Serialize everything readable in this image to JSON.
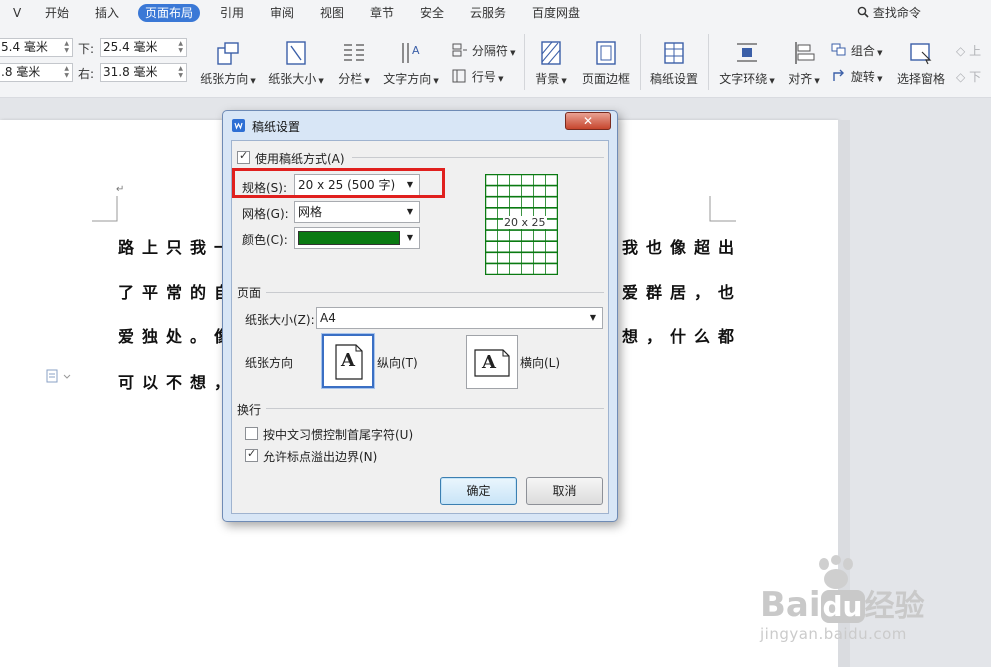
{
  "menu": {
    "collapse_glyph": "ᐯ",
    "items": [
      "开始",
      "插入",
      "页面布局",
      "引用",
      "审阅",
      "视图",
      "章节",
      "安全",
      "云服务",
      "百度网盘"
    ],
    "active_index": 2,
    "search_label": "查找命令"
  },
  "margins": {
    "top_value": "5.4 毫米",
    "left_value": ".8 毫米",
    "bottom_label": "下:",
    "bottom_value": "25.4 毫米",
    "right_label": "右:",
    "right_value": "31.8 毫米"
  },
  "ribbon": {
    "orientation": "纸张方向",
    "size": "纸张大小",
    "columns": "分栏",
    "text_direction": "文字方向",
    "separator": "分隔符",
    "line_number": "行号",
    "background": "背景",
    "page_border": "页面边框",
    "manuscript": "稿纸设置",
    "wrap": "文字环绕",
    "align": "对齐",
    "group": "组合",
    "rotate": "旋转",
    "selection_pane": "选择窗格",
    "up": "上",
    "down": "下"
  },
  "document": {
    "lines": [
      "路上只我一",
      "了平常的自",
      "爱独处。像",
      "可以不想，"
    ],
    "right_lines": [
      "我也像超出",
      "爱群居，也",
      "想，什么都",
      ""
    ]
  },
  "dialog": {
    "title": "稿纸设置",
    "use_manuscript_label": "使用稿纸方式(A)",
    "use_manuscript_checked": true,
    "spec_label": "规格(S):",
    "spec_value": "20 x 25 (500 字)",
    "grid_label": "网格(G):",
    "grid_value": "网格",
    "color_label": "颜色(C):",
    "color_value": "#0a7a12",
    "preview_text": "20 x 25",
    "page_section": "页面",
    "paper_size_label": "纸张大小(Z):",
    "paper_size_value": "A4",
    "orientation_label": "纸张方向",
    "portrait_label": "纵向(T)",
    "landscape_label": "横向(L)",
    "icon_letter": "A",
    "wrap_section": "换行",
    "cjk_control_label": "按中文习惯控制首尾字符(U)",
    "cjk_control_checked": false,
    "punct_overflow_label": "允许标点溢出边界(N)",
    "punct_overflow_checked": true,
    "ok_label": "确定",
    "cancel_label": "取消"
  },
  "watermark": {
    "brand_left": "Bai",
    "brand_mid": "du",
    "brand_right": "经验",
    "url": "jingyan.baidu.com"
  },
  "colors": {
    "accent": "#3a78d6",
    "highlight": "#e0201e",
    "grid_green": "#0a7a12"
  }
}
